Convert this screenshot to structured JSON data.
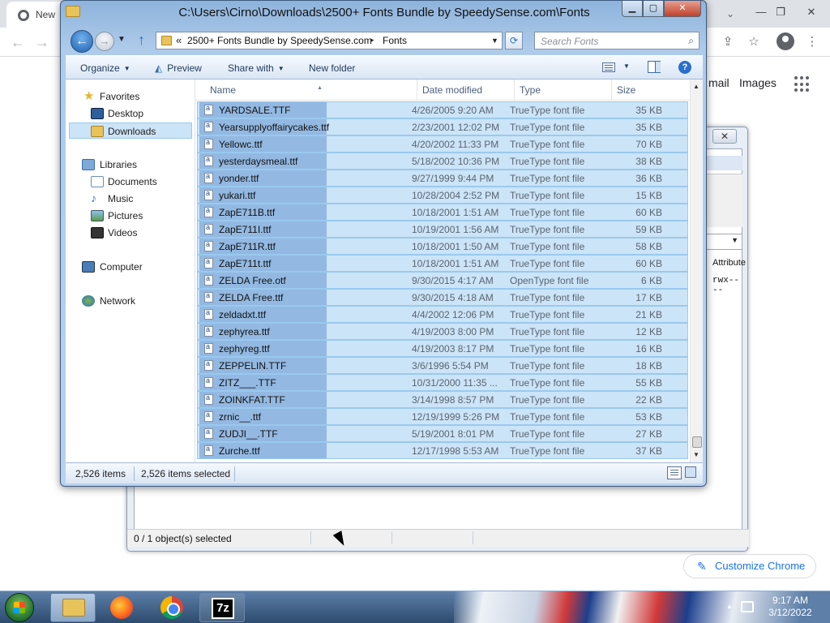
{
  "chrome": {
    "tab_label": "New",
    "gmail": "mail",
    "images": "Images",
    "customize": "Customize Chrome"
  },
  "zip_dialog": {
    "close_label": "✕",
    "attributes_header": "Attribute",
    "attributes_value": "rwx----",
    "status": "0 / 1 object(s) selected"
  },
  "explorer": {
    "title": "C:\\Users\\Cirno\\Downloads\\2500+ Fonts Bundle by SpeedySense.com\\Fonts",
    "address": {
      "chevron": "«",
      "crumb1": "2500+ Fonts Bundle by SpeedySense.com",
      "separator": "▸",
      "crumb2": "Fonts"
    },
    "search_placeholder": "Search Fonts",
    "toolbar": {
      "organize": "Organize",
      "preview": "Preview",
      "share_with": "Share with",
      "new_folder": "New folder"
    },
    "nav": {
      "favorites": "Favorites",
      "desktop": "Desktop",
      "downloads": "Downloads",
      "libraries": "Libraries",
      "documents": "Documents",
      "music": "Music",
      "pictures": "Pictures",
      "videos": "Videos",
      "computer": "Computer",
      "network": "Network"
    },
    "columns": {
      "name": "Name",
      "date": "Date modified",
      "type": "Type",
      "size": "Size"
    },
    "files": [
      {
        "name": "YARDSALE.TTF",
        "date": "4/26/2005 9:20 AM",
        "type": "TrueType font file",
        "size": "35 KB"
      },
      {
        "name": "Yearsupplyoffairycakes.ttf",
        "date": "2/23/2001 12:02 PM",
        "type": "TrueType font file",
        "size": "35 KB"
      },
      {
        "name": "Yellowc.ttf",
        "date": "4/20/2002 11:33 PM",
        "type": "TrueType font file",
        "size": "70 KB"
      },
      {
        "name": "yesterdaysmeal.ttf",
        "date": "5/18/2002 10:36 PM",
        "type": "TrueType font file",
        "size": "38 KB"
      },
      {
        "name": "yonder.ttf",
        "date": "9/27/1999 9:44 PM",
        "type": "TrueType font file",
        "size": "36 KB"
      },
      {
        "name": "yukari.ttf",
        "date": "10/28/2004 2:52 PM",
        "type": "TrueType font file",
        "size": "15 KB"
      },
      {
        "name": "ZapE711B.ttf",
        "date": "10/18/2001 1:51 AM",
        "type": "TrueType font file",
        "size": "60 KB"
      },
      {
        "name": "ZapE711I.ttf",
        "date": "10/19/2001 1:56 AM",
        "type": "TrueType font file",
        "size": "59 KB"
      },
      {
        "name": "ZapE711R.ttf",
        "date": "10/18/2001 1:50 AM",
        "type": "TrueType font file",
        "size": "58 KB"
      },
      {
        "name": "ZapE711t.ttf",
        "date": "10/18/2001 1:51 AM",
        "type": "TrueType font file",
        "size": "60 KB"
      },
      {
        "name": "ZELDA Free.otf",
        "date": "9/30/2015 4:17 AM",
        "type": "OpenType font file",
        "size": "6 KB"
      },
      {
        "name": "ZELDA Free.ttf",
        "date": "9/30/2015 4:18 AM",
        "type": "TrueType font file",
        "size": "17 KB"
      },
      {
        "name": "zeldadxt.ttf",
        "date": "4/4/2002 12:06 PM",
        "type": "TrueType font file",
        "size": "21 KB"
      },
      {
        "name": "zephyrea.ttf",
        "date": "4/19/2003 8:00 PM",
        "type": "TrueType font file",
        "size": "12 KB"
      },
      {
        "name": "zephyreg.ttf",
        "date": "4/19/2003 8:17 PM",
        "type": "TrueType font file",
        "size": "16 KB"
      },
      {
        "name": "ZEPPELIN.TTF",
        "date": "3/6/1996 5:54 PM",
        "type": "TrueType font file",
        "size": "18 KB"
      },
      {
        "name": "ZITZ___.TTF",
        "date": "10/31/2000 11:35 ...",
        "type": "TrueType font file",
        "size": "55 KB"
      },
      {
        "name": "ZOINKFAT.TTF",
        "date": "3/14/1998 8:57 PM",
        "type": "TrueType font file",
        "size": "22 KB"
      },
      {
        "name": "zrnic__.ttf",
        "date": "12/19/1999 5:26 PM",
        "type": "TrueType font file",
        "size": "53 KB"
      },
      {
        "name": "ZUDJI__.TTF",
        "date": "5/19/2001 8:01 PM",
        "type": "TrueType font file",
        "size": "27 KB"
      },
      {
        "name": "Zurche.ttf",
        "date": "12/17/1998 5:53 AM",
        "type": "TrueType font file",
        "size": "37 KB"
      }
    ],
    "status": {
      "count": "2,526 items",
      "selected": "2,526 items selected"
    }
  },
  "taskbar": {
    "sevenzip_label": "7z",
    "time": "9:17 AM",
    "date": "3/12/2022"
  }
}
